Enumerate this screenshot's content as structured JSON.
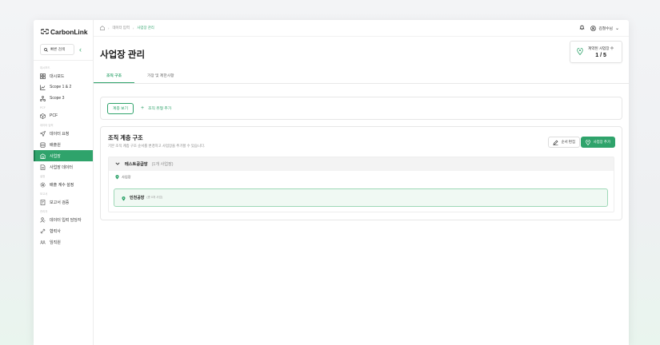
{
  "app": {
    "brand": "CarbonLink"
  },
  "sidebar": {
    "search_label": "빠른 검색",
    "sections": [
      {
        "label": "대시보드",
        "items": [
          {
            "label": "대시보드",
            "icon": "grid-icon"
          },
          {
            "label": "Scope 1 & 2",
            "icon": "chart-icon"
          },
          {
            "label": "Scope 3",
            "icon": "network-icon"
          }
        ]
      },
      {
        "label": "PCF",
        "items": [
          {
            "label": "PCF",
            "icon": "cube-icon"
          }
        ]
      },
      {
        "label": "데이터 입력",
        "items": [
          {
            "label": "데이터 요청",
            "icon": "send-icon"
          },
          {
            "label": "배출원",
            "icon": "database-icon"
          },
          {
            "label": "사업장",
            "icon": "building-icon",
            "active": true
          },
          {
            "label": "사업장 데이터",
            "icon": "document-icon"
          }
        ]
      },
      {
        "label": "설정",
        "items": [
          {
            "label": "배출 계수 설정",
            "icon": "gear-icon"
          }
        ]
      },
      {
        "label": "보고서",
        "items": [
          {
            "label": "보고서 검증",
            "icon": "report-icon"
          }
        ]
      },
      {
        "label": "관리자",
        "items": [
          {
            "label": "데이터 입력 담당자",
            "icon": "user-icon"
          },
          {
            "label": "협력사",
            "icon": "link-icon"
          },
          {
            "label": "임직원",
            "icon": "people-icon"
          }
        ]
      }
    ]
  },
  "topbar": {
    "breadcrumb": [
      "데이터 입력",
      "사업장 관리"
    ],
    "user_name": "김철수님"
  },
  "header": {
    "title": "사업장 관리",
    "count_label": "계약된 사업장 수",
    "count_value": "1 / 5"
  },
  "tabs": [
    {
      "label": "조직 구조",
      "active": true
    },
    {
      "label": "가장 및 제한사항",
      "active": false
    }
  ],
  "toolbar": {
    "view_button": "계층 보기",
    "add_type": "조직 유형 추가"
  },
  "structure": {
    "title": "조직 계층 구조",
    "description": "기본 조직 계층 구조 순서를 변경하고 사업장을 추가할 수 있습니다.",
    "edit_button": "순서 편집",
    "add_button": "사업장 추가",
    "group_name": "테스트공급망",
    "group_count": "(1개 사업장)",
    "site_label": "사업장",
    "site_name": "인천공장",
    "site_sub": "(총 0개 사업)"
  },
  "colors": {
    "accent": "#2fa36b"
  }
}
